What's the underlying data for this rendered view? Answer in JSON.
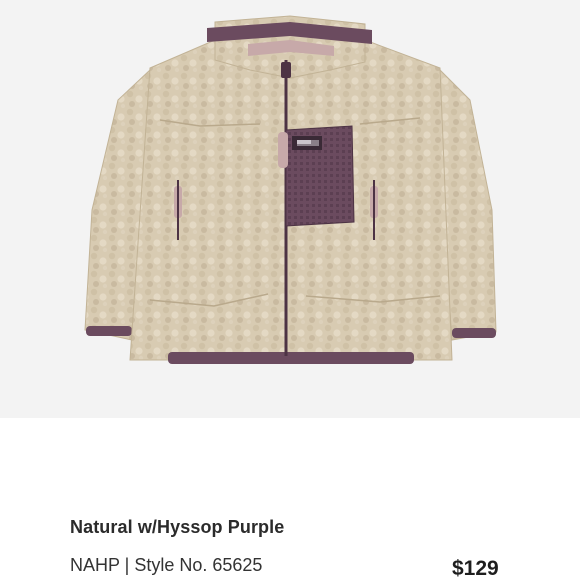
{
  "product": {
    "image_alt": "Fleece jacket in Natural with Hyssop Purple trim",
    "brand_mark": "patagonia",
    "color_name": "Natural w/Hyssop Purple",
    "style_line": "NAHP | Style No. 65625",
    "price": "$129"
  },
  "colors": {
    "fleece": "#d8cbb2",
    "trim": "#6b4b5f",
    "pull_tab": "#c7a9a9",
    "background": "#f3f3f3"
  }
}
